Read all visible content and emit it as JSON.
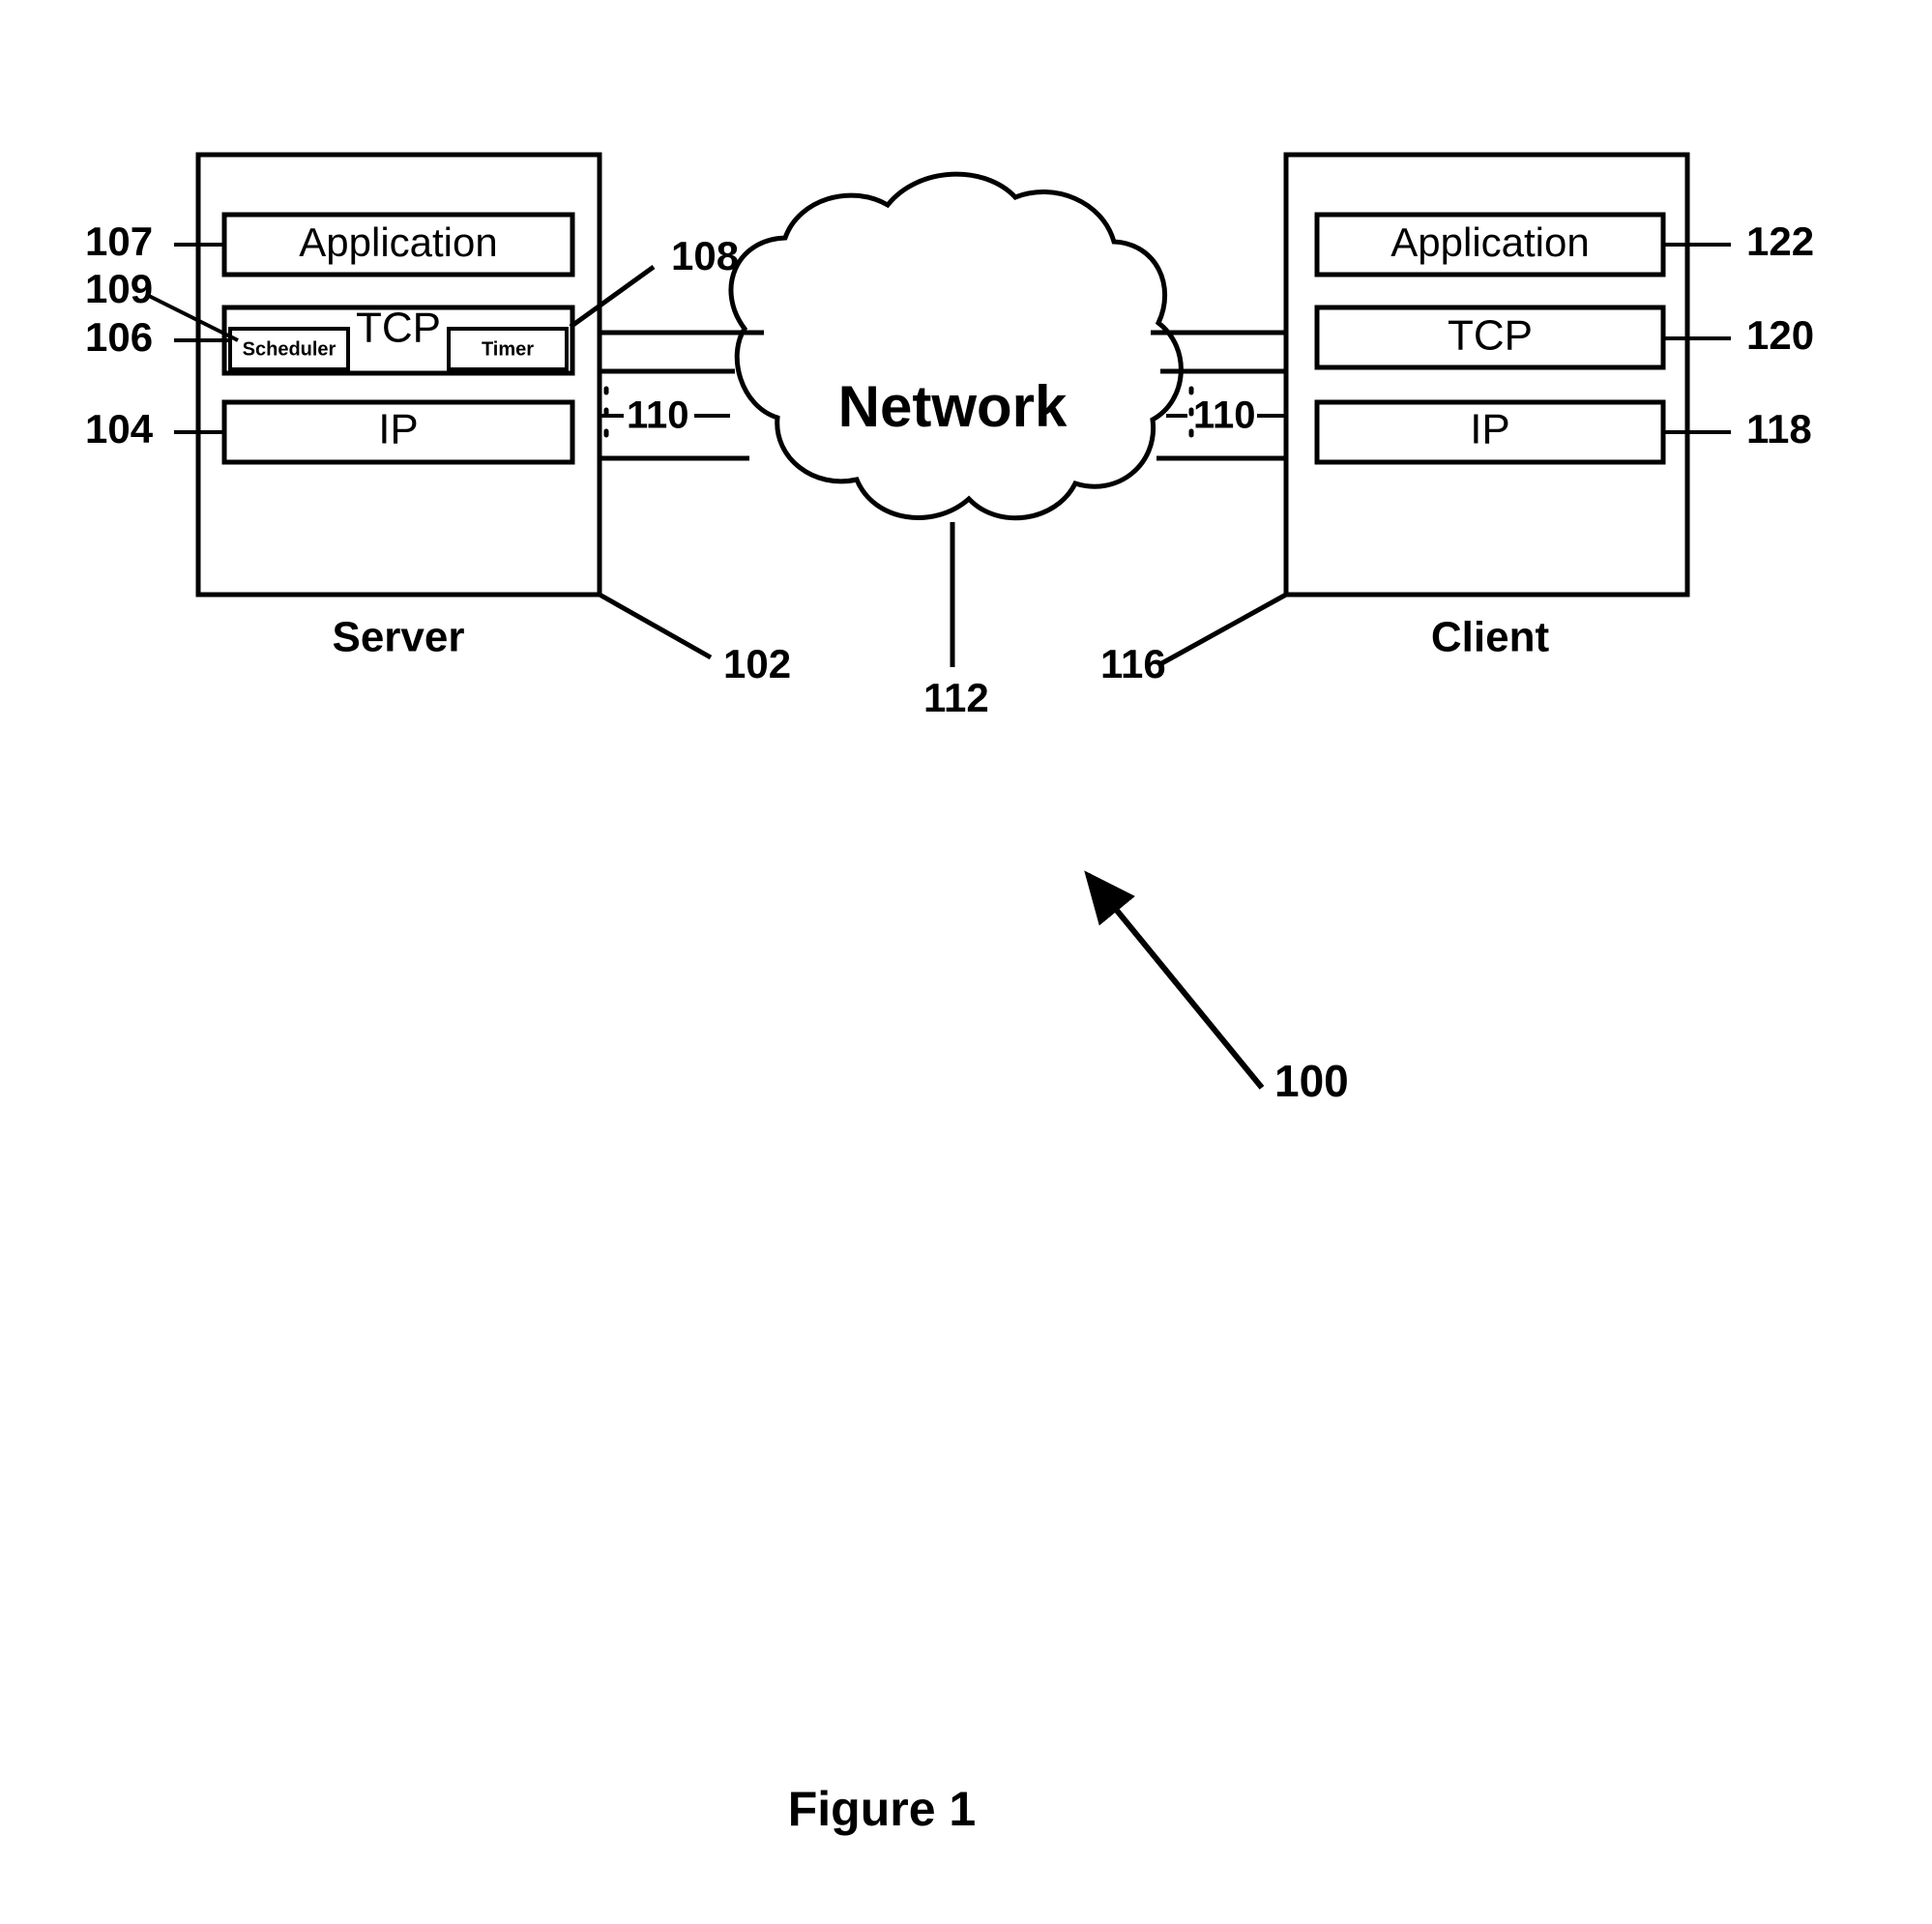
{
  "figure": {
    "caption": "Figure 1",
    "overall_ref": "100"
  },
  "server": {
    "name": "Server",
    "ref": "102",
    "layers": [
      {
        "label": "Application",
        "ref": "107"
      },
      {
        "label": "TCP",
        "ref": "106"
      },
      {
        "label": "IP",
        "ref": "104"
      }
    ],
    "tcp_subcomponents": [
      {
        "label": "Scheduler",
        "ref": "109"
      },
      {
        "label": "Timer",
        "ref": "108"
      }
    ],
    "connection_ref": "110"
  },
  "network": {
    "label": "Network",
    "ref": "112"
  },
  "client": {
    "name": "Client",
    "ref": "116",
    "layers": [
      {
        "label": "Application",
        "ref": "122"
      },
      {
        "label": "TCP",
        "ref": "120"
      },
      {
        "label": "IP",
        "ref": "118"
      }
    ],
    "connection_ref": "110"
  },
  "colors": {
    "ink": "#000000",
    "paper": "#ffffff"
  }
}
